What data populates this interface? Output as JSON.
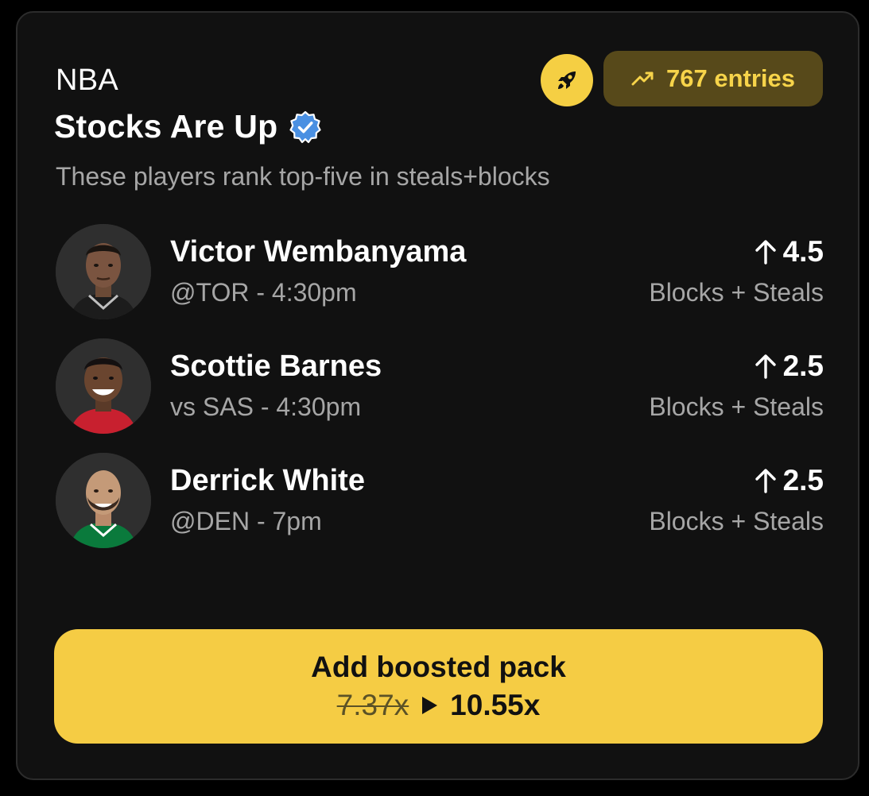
{
  "header": {
    "league": "NBA",
    "title": "Stocks Are Up",
    "subtitle": "These players rank top-five in steals+blocks",
    "entries_label": "767 entries",
    "icons": [
      "rocket-icon",
      "trend-up-icon",
      "verified-badge-icon"
    ]
  },
  "players": [
    {
      "name": "Victor Wembanyama",
      "matchup": "@TOR - 4:30pm",
      "line": "4.5",
      "stat": "Blocks + Steals",
      "jersey_color": "#1c1c1c"
    },
    {
      "name": "Scottie Barnes",
      "matchup": "vs SAS - 4:30pm",
      "line": "2.5",
      "stat": "Blocks + Steals",
      "jersey_color": "#c8202f"
    },
    {
      "name": "Derrick White",
      "matchup": "@DEN - 7pm",
      "line": "2.5",
      "stat": "Blocks + Steals",
      "jersey_color": "#0a7a3c"
    }
  ],
  "cta": {
    "label": "Add boosted pack",
    "old_multiplier": "7.37x",
    "new_multiplier": "10.55x"
  },
  "colors": {
    "accent": "#f5cc44",
    "badge_bg": "#57491a",
    "badge_text": "#f7d44a",
    "verified": "#4a90e2",
    "card_bg": "#111111"
  }
}
